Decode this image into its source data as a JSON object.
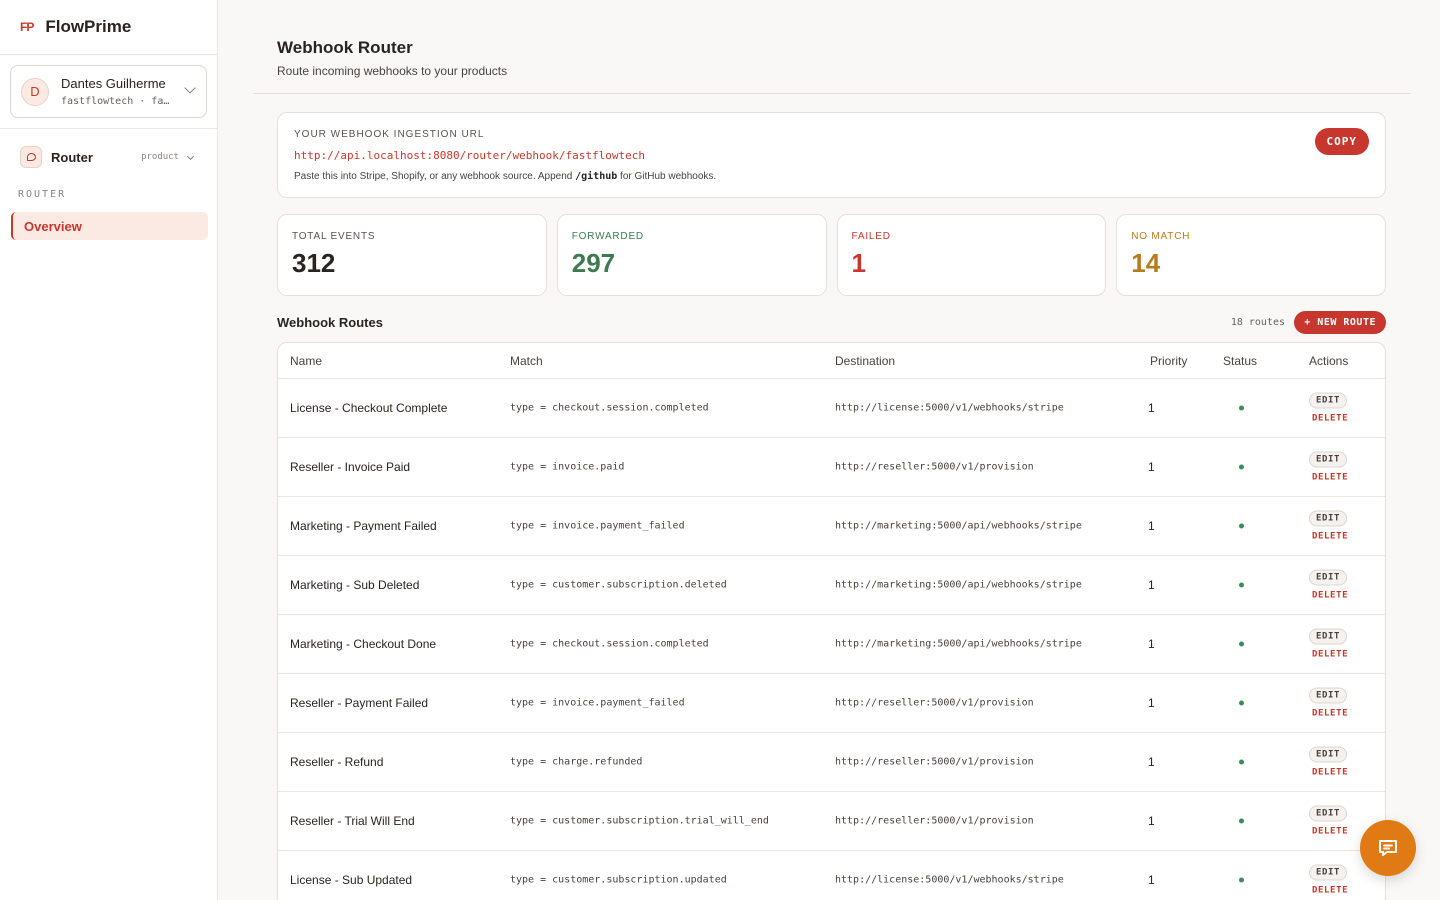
{
  "brand": {
    "mark": "FP",
    "name": "FlowPrime"
  },
  "account": {
    "initial": "D",
    "name": "Dantes Guilherme",
    "sub": "fastflowtech  ·  fa…"
  },
  "product": {
    "name": "Router",
    "tag": "product"
  },
  "nav": {
    "section": "ROUTER",
    "items": [
      {
        "label": "Overview",
        "active": true
      }
    ]
  },
  "page": {
    "title": "Webhook Router",
    "subtitle": "Route incoming webhooks to your products"
  },
  "ingestion": {
    "label": "YOUR WEBHOOK INGESTION URL",
    "url": "http://api.localhost:8080/router/webhook/fastflowtech",
    "help_prefix": "Paste this into Stripe, Shopify, or any webhook source. Append",
    "help_code": "/github",
    "help_suffix": "for GitHub webhooks.",
    "copy_label": "COPY"
  },
  "stats": [
    {
      "label": "TOTAL EVENTS",
      "value": "312",
      "color": "#2a2320"
    },
    {
      "label": "FORWARDED",
      "value": "297",
      "color": "#3d7a52"
    },
    {
      "label": "FAILED",
      "value": "1",
      "color": "#c8372d"
    },
    {
      "label": "NO MATCH",
      "value": "14",
      "color": "#b97a1e"
    }
  ],
  "routes": {
    "title": "Webhook Routes",
    "count": "18 routes",
    "new_label": "+ NEW ROUTE",
    "columns": [
      "Name",
      "Match",
      "Destination",
      "Priority",
      "Status",
      "Actions"
    ],
    "edit_label": "EDIT",
    "delete_label": "DELETE",
    "status_color": "#3d8a5c",
    "rows": [
      {
        "name": "License - Checkout Complete",
        "match": "type = checkout.session.completed",
        "dest": "http://license:5000/v1/webhooks/stripe",
        "priority": "1"
      },
      {
        "name": "Reseller - Invoice Paid",
        "match": "type = invoice.paid",
        "dest": "http://reseller:5000/v1/provision",
        "priority": "1"
      },
      {
        "name": "Marketing - Payment Failed",
        "match": "type = invoice.payment_failed",
        "dest": "http://marketing:5000/api/webhooks/stripe",
        "priority": "1"
      },
      {
        "name": "Marketing - Sub Deleted",
        "match": "type = customer.subscription.deleted",
        "dest": "http://marketing:5000/api/webhooks/stripe",
        "priority": "1"
      },
      {
        "name": "Marketing - Checkout Done",
        "match": "type = checkout.session.completed",
        "dest": "http://marketing:5000/api/webhooks/stripe",
        "priority": "1"
      },
      {
        "name": "Reseller - Payment Failed",
        "match": "type = invoice.payment_failed",
        "dest": "http://reseller:5000/v1/provision",
        "priority": "1"
      },
      {
        "name": "Reseller - Refund",
        "match": "type = charge.refunded",
        "dest": "http://reseller:5000/v1/provision",
        "priority": "1"
      },
      {
        "name": "Reseller - Trial Will End",
        "match": "type = customer.subscription.trial_will_end",
        "dest": "http://reseller:5000/v1/provision",
        "priority": "1"
      },
      {
        "name": "License - Sub Updated",
        "match": "type = customer.subscription.updated",
        "dest": "http://license:5000/v1/webhooks/stripe",
        "priority": "1"
      }
    ]
  },
  "chat": {
    "icon": "chat-icon"
  }
}
